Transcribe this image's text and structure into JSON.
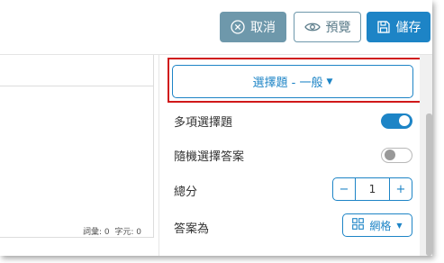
{
  "toolbar": {
    "cancel_label": "取消",
    "preview_label": "預覽",
    "save_label": "儲存"
  },
  "editor": {
    "word_count_label": "詞彙: 0",
    "char_count_label": "字元: 0"
  },
  "settings": {
    "question_type": "選擇題 - 一般",
    "multi_select_label": "多項選擇題",
    "multi_select_on": true,
    "random_order_label": "隨機選擇答案",
    "random_order_on": false,
    "score_label": "總分",
    "score_value": "1",
    "answer_layout_label": "答案為",
    "answer_layout_value": "網格"
  },
  "colors": {
    "accent": "#1d84c6",
    "cancel": "#6e98ab",
    "highlight": "#d0191a"
  }
}
